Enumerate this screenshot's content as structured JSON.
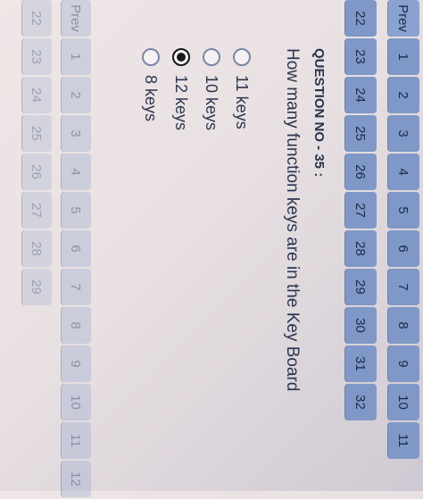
{
  "pagination": {
    "prev_label": "Prev",
    "row1": [
      "1",
      "2",
      "3",
      "4",
      "5",
      "6",
      "7",
      "8",
      "9",
      "10",
      "11"
    ],
    "row2": [
      "22",
      "23",
      "24",
      "25",
      "26",
      "27",
      "28",
      "29",
      "30",
      "31",
      "32"
    ]
  },
  "faded_pagination": {
    "prev_label": "Prev",
    "row1": [
      "1",
      "2",
      "3",
      "4",
      "5",
      "6",
      "7",
      "8",
      "9",
      "10",
      "11",
      "12"
    ],
    "row2": [
      "22",
      "23",
      "24",
      "25",
      "26",
      "27",
      "28",
      "29"
    ]
  },
  "question": {
    "title": "QUESTION NO - 35 :",
    "text": "How many function keys are in the Key Board",
    "options": [
      "11 keys",
      "10 keys",
      "12 keys",
      "8 keys"
    ],
    "selected_index": 2
  }
}
